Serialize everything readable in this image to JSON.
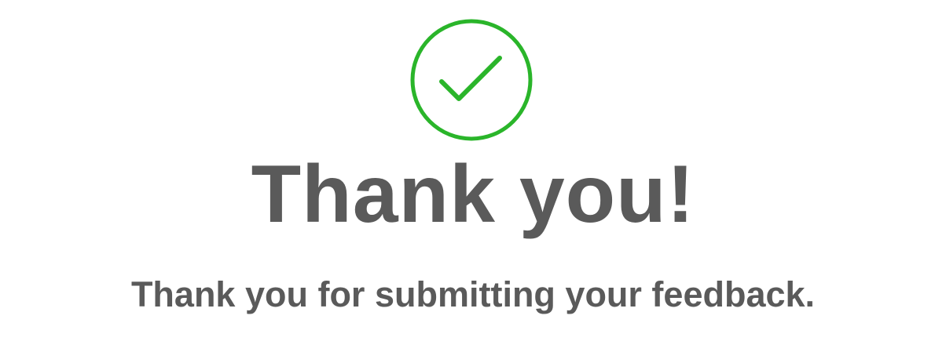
{
  "confirmation": {
    "icon": "check-circle-icon",
    "accent_color": "#2ab52a",
    "text_color": "#5a5a5a",
    "title": "Thank you!",
    "message": "Thank you for submitting your feedback."
  }
}
